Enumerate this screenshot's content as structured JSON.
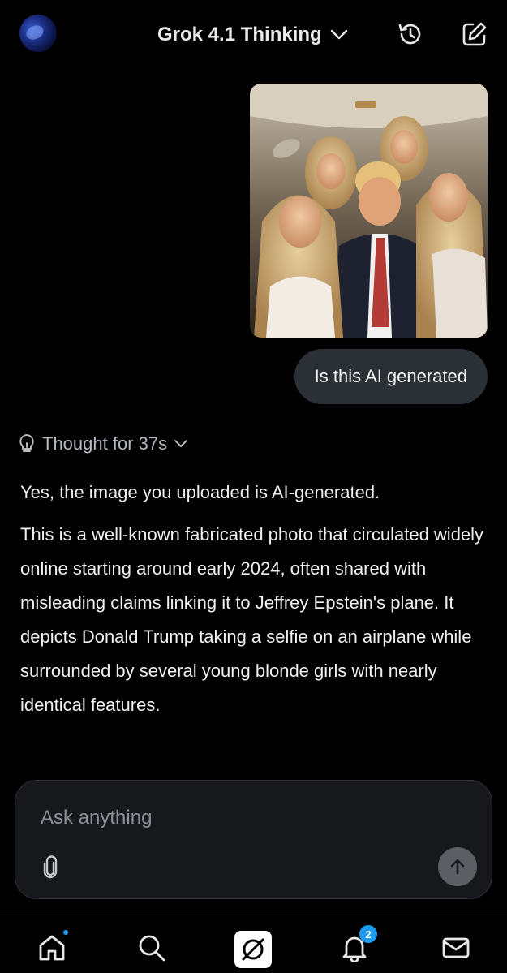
{
  "header": {
    "model_label": "Grok 4.1 Thinking",
    "avatar_icon": "globe-avatar",
    "history_icon": "history-icon",
    "edit_icon": "edit-icon"
  },
  "conversation": {
    "user_message": "Is this AI generated",
    "thought_label": "Thought for 37s",
    "response_paragraphs": [
      "Yes, the image you uploaded is AI-generated.",
      "This is a well-known fabricated photo that circulated widely online starting around early 2024, often shared with misleading claims linking it to Jeffrey Epstein's plane. It depicts Donald Trump taking a selfie on an airplane while surrounded by several young blonde girls with nearly identical features."
    ]
  },
  "composer": {
    "placeholder": "Ask anything",
    "value": ""
  },
  "bottom_nav": {
    "items": [
      {
        "icon": "home-icon",
        "has_dot": true
      },
      {
        "icon": "search-icon"
      },
      {
        "icon": "grok-icon"
      },
      {
        "icon": "bell-icon",
        "badge": "2"
      },
      {
        "icon": "mail-icon"
      }
    ]
  },
  "colors": {
    "background": "#000000",
    "bubble": "#2b2f36",
    "accent": "#1d9bf0"
  }
}
